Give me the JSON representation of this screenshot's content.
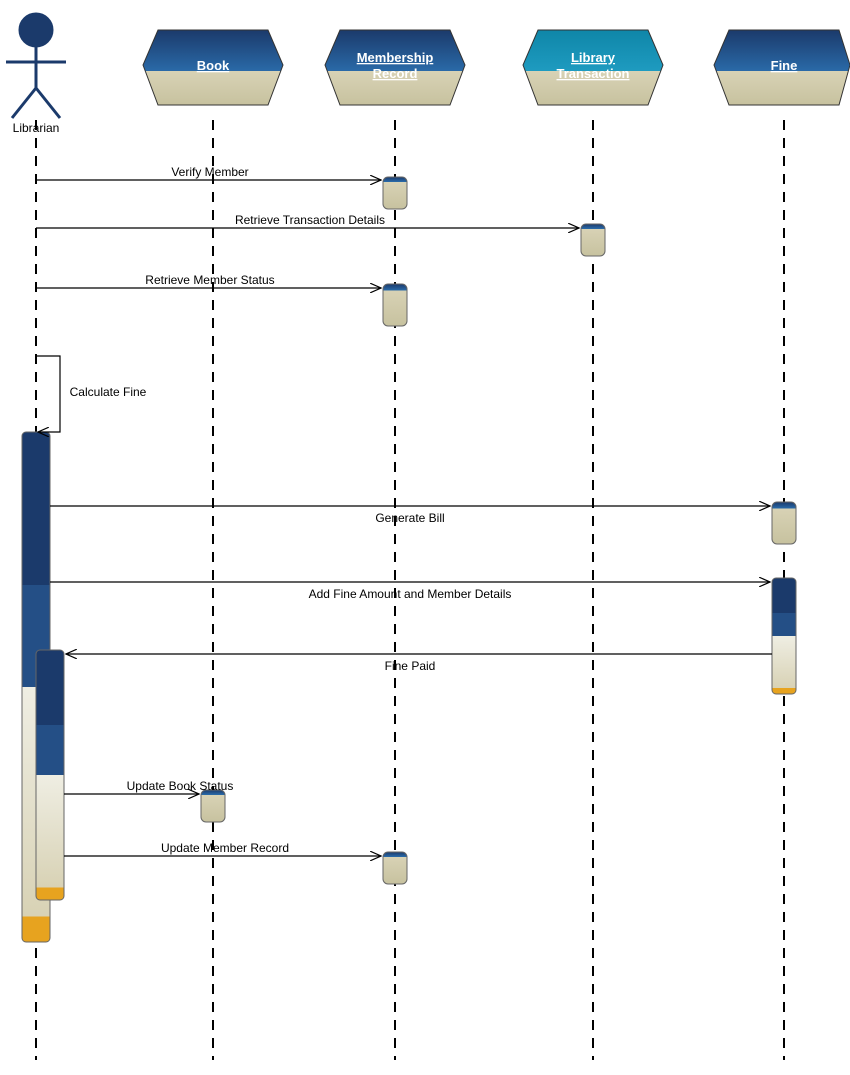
{
  "actor": {
    "label": "Librarian"
  },
  "objects": {
    "book": {
      "label": "Book"
    },
    "membership": {
      "label1": "Membership",
      "label2": "Record"
    },
    "transaction": {
      "label1": "Library",
      "label2": "Transaction"
    },
    "fine": {
      "label": "Fine"
    }
  },
  "messages": {
    "m1": "Verify Member",
    "m2": "Retrieve Transaction Details",
    "m3": "Retrieve Member Status",
    "m4": "Calculate Fine",
    "m5": "Generate Bill",
    "m6": "Add Fine Amount and Member Details",
    "m7": "Fine Paid",
    "m8": "Update Book Status",
    "m9": "Update Member Record"
  }
}
